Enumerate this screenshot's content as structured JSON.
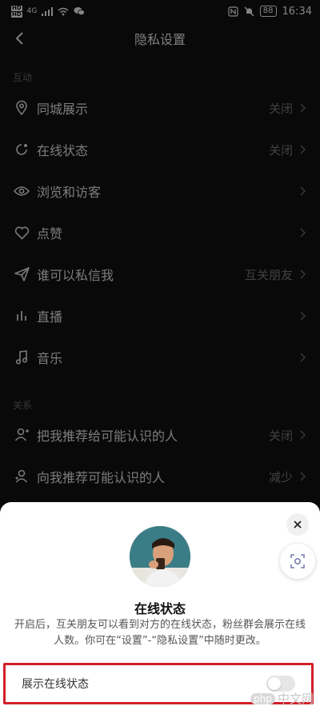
{
  "statusbar": {
    "time": "16:34",
    "battery": "88",
    "network": "4G"
  },
  "navbar": {
    "title": "隐私设置"
  },
  "sections": {
    "interaction": "互动",
    "relations": "关系"
  },
  "settings": [
    {
      "label": "同城展示",
      "value": "关闭",
      "icon": "location-icon"
    },
    {
      "label": "在线状态",
      "value": "关闭",
      "icon": "online-status-icon"
    },
    {
      "label": "浏览和访客",
      "value": "",
      "icon": "eye-icon"
    },
    {
      "label": "点赞",
      "value": "",
      "icon": "heart-icon"
    },
    {
      "label": "谁可以私信我",
      "value": "互关朋友",
      "icon": "send-icon"
    },
    {
      "label": "直播",
      "value": "",
      "icon": "live-bars-icon"
    },
    {
      "label": "音乐",
      "value": "",
      "icon": "music-note-icon"
    }
  ],
  "relations": [
    {
      "label": "把我推荐给可能认识的人",
      "value": "关闭",
      "icon": "user-recommend-icon"
    },
    {
      "label": "向我推荐可能认识的人",
      "value": "减少",
      "icon": "users-recommend-icon"
    }
  ],
  "sheet": {
    "title": "在线状态",
    "description": "开启后，互关朋友可以看到对方的在线状态，粉丝群会展示在线人数。你可在“设置”-“隐私设置”中随时更改。",
    "toggle_label": "展示在线状态",
    "toggle_on": false
  },
  "watermark": {
    "logo": "php",
    "text": "中文网"
  },
  "colors": {
    "background": "#121212",
    "highlight": "#d21f2a",
    "sheet": "#ffffff"
  }
}
